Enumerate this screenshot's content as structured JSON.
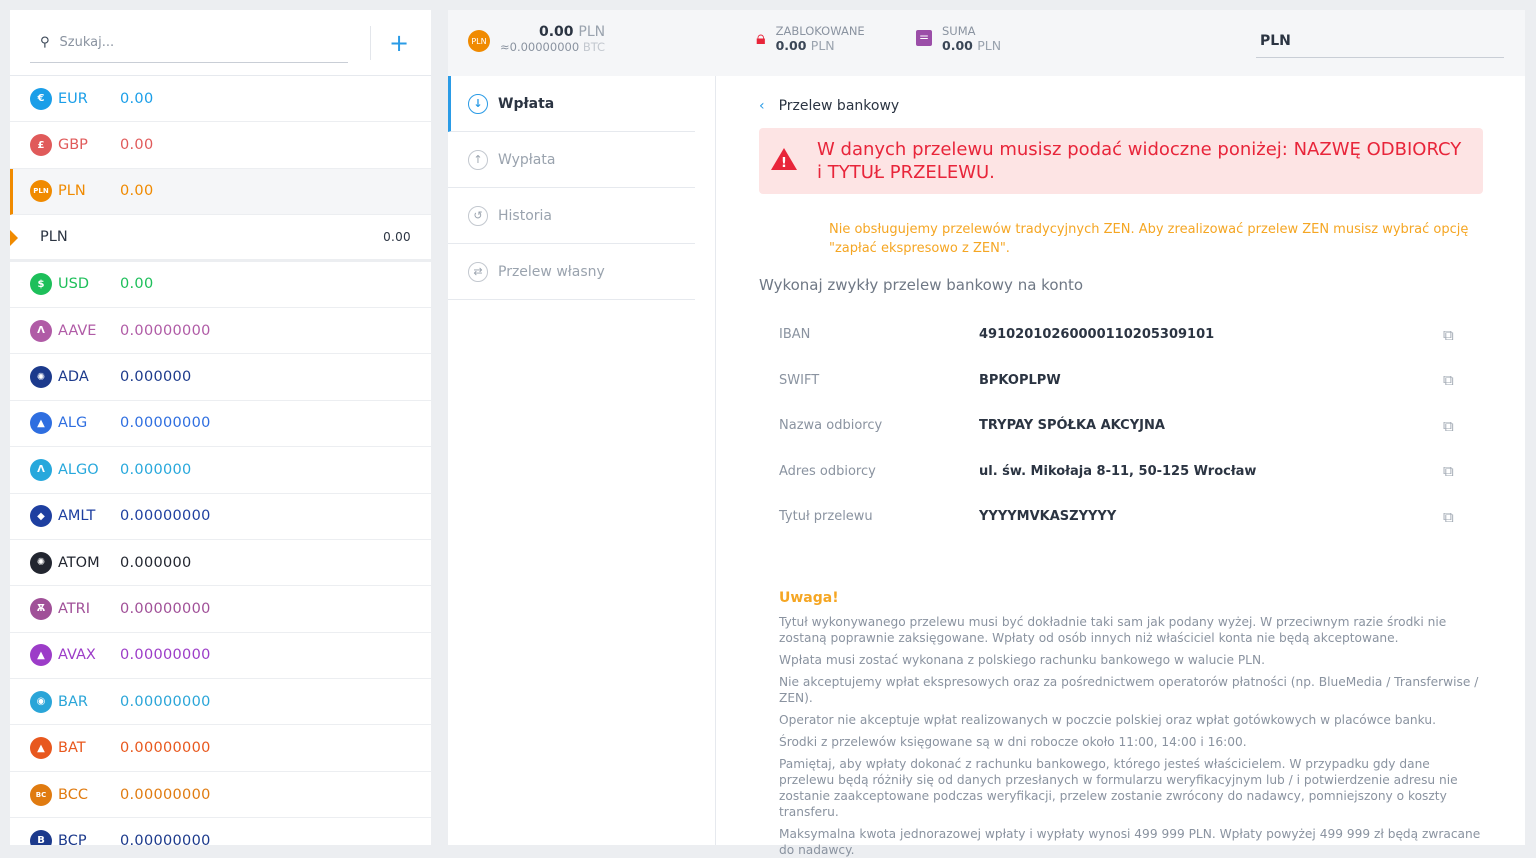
{
  "search": {
    "placeholder": "Szukaj...",
    "add": "+"
  },
  "currencies": [
    {
      "code": "EUR",
      "amount": "0.00",
      "color": "#1a9ee8",
      "icon": "€"
    },
    {
      "code": "GBP",
      "amount": "0.00",
      "color": "#e05a5a",
      "icon": "£"
    },
    {
      "code": "PLN",
      "amount": "0.00",
      "color": "#f08a00",
      "icon": "PLN",
      "active": true
    },
    {
      "code": "PLN",
      "amount": "0.00",
      "sub": true
    },
    {
      "code": "USD",
      "amount": "0.00",
      "color": "#1dbf5a",
      "icon": "$"
    },
    {
      "code": "AAVE",
      "amount": "0.00000000",
      "color": "#b05ba6",
      "icon": "Λ"
    },
    {
      "code": "ADA",
      "amount": "0.000000",
      "color": "#1c3a8c",
      "icon": "✺"
    },
    {
      "code": "ALG",
      "amount": "0.00000000",
      "color": "#2e6ee0",
      "icon": "▲"
    },
    {
      "code": "ALGO",
      "amount": "0.000000",
      "color": "#27a8dc",
      "icon": "Λ"
    },
    {
      "code": "AMLT",
      "amount": "0.00000000",
      "color": "#1e3fa0",
      "icon": "◆"
    },
    {
      "code": "ATOM",
      "amount": "0.000000",
      "color": "#222630",
      "icon": "✺"
    },
    {
      "code": "ATRI",
      "amount": "0.00000000",
      "color": "#a05098",
      "icon": "Ѫ"
    },
    {
      "code": "AVAX",
      "amount": "0.00000000",
      "color": "#9c3cc8",
      "icon": "▲"
    },
    {
      "code": "BAR",
      "amount": "0.00000000",
      "color": "#2aa5d8",
      "icon": "◉"
    },
    {
      "code": "BAT",
      "amount": "0.00000000",
      "color": "#e8581e",
      "icon": "▲"
    },
    {
      "code": "BCC",
      "amount": "0.00000000",
      "color": "#e07b10",
      "icon": "BC"
    },
    {
      "code": "BCP",
      "amount": "0.00000000",
      "color": "#1c3a8c",
      "icon": "B"
    }
  ],
  "header": {
    "coin": "PLN",
    "balance": "0.00",
    "balance_cur": "PLN",
    "btc": "≈0.00000000",
    "btc_cur": "BTC",
    "blocked_label": "ZABLOKOWANE",
    "blocked": "0.00",
    "blocked_cur": "PLN",
    "sum_label": "SUMA",
    "sum": "0.00",
    "sum_cur": "PLN",
    "currency": "PLN"
  },
  "nav": [
    "Wpłata",
    "Wypłata",
    "Historia",
    "Przelew własny"
  ],
  "content": {
    "back": "Przelew bankowy",
    "alert": "W danych przelewu musisz podać widoczne poniżej: NAZWĘ ODBIORCY i TYTUŁ PRZELEWU.",
    "warning": "Nie obsługujemy przelewów tradycyjnych ZEN. Aby zrealizować przelew ZEN musisz wybrać opcję \"zapłać ekspresowo z ZEN\".",
    "lead": "Wykonaj zwykły przelew bankowy na konto",
    "fields": [
      {
        "label": "IBAN",
        "value": "49102010260000110205309101"
      },
      {
        "label": "SWIFT",
        "value": "BPKOPLPW"
      },
      {
        "label": "Nazwa odbiorcy",
        "value": "TRYPAY SPÓŁKA AKCYJNA"
      },
      {
        "label": "Adres odbiorcy",
        "value": "ul. św. Mikołaja 8-11, 50-125 Wrocław"
      },
      {
        "label": "Tytuł przelewu",
        "value": "YYYYMVKASZYYYY"
      }
    ],
    "notice_title": "Uwaga!",
    "notes": [
      "Tytuł wykonywanego przelewu musi być dokładnie taki sam jak podany wyżej. W przeciwnym razie środki nie zostaną poprawnie zaksięgowane. Wpłaty od osób innych niż właściciel konta nie będą akceptowane.",
      "Wpłata musi zostać wykonana z polskiego rachunku bankowego w walucie PLN.",
      "Nie akceptujemy wpłat ekspresowych oraz za pośrednictwem operatorów płatności (np. BlueMedia / Transferwise / ZEN).",
      "Operator nie akceptuje wpłat realizowanych w poczcie polskiej oraz wpłat gotówkowych w placówce banku.",
      "Środki z przelewów księgowane są w dni robocze około 11:00, 14:00 i 16:00.",
      "Pamiętaj, aby wpłaty dokonać z rachunku bankowego, którego jesteś właścicielem. W przypadku gdy dane przelewu będą różniły się od danych przesłanych w formularzu weryfikacyjnym lub / i potwierdzenie adresu nie zostanie zaakceptowane podczas weryfikacji, przelew zostanie zwrócony do nadawcy, pomniejszony o koszty transferu.",
      "Maksymalna kwota jednorazowej wpłaty i wypłaty wynosi 499 999 PLN. Wpłaty powyżej 499 999 zł będą zwracane do nadawcy."
    ]
  }
}
